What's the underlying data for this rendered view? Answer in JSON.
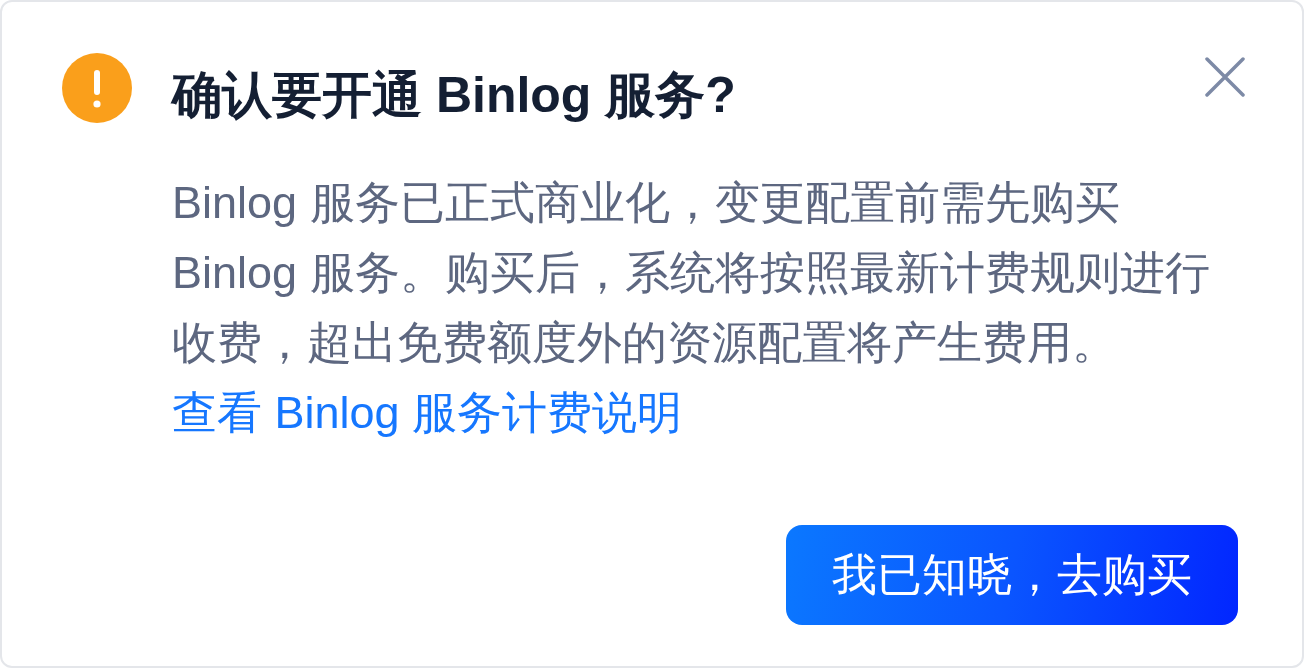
{
  "dialog": {
    "title": "确认要开通 Binlog 服务?",
    "message": "Binlog 服务已正式商业化，变更配置前需先购买 Binlog 服务。购买后，系统将按照最新计费规则进行收费，超出免费额度外的资源配置将产生费用。",
    "link": "查看 Binlog 服务计费说明",
    "buttons": [
      {
        "label": "我已知晓，去购买",
        "kind": "primary"
      }
    ]
  }
}
